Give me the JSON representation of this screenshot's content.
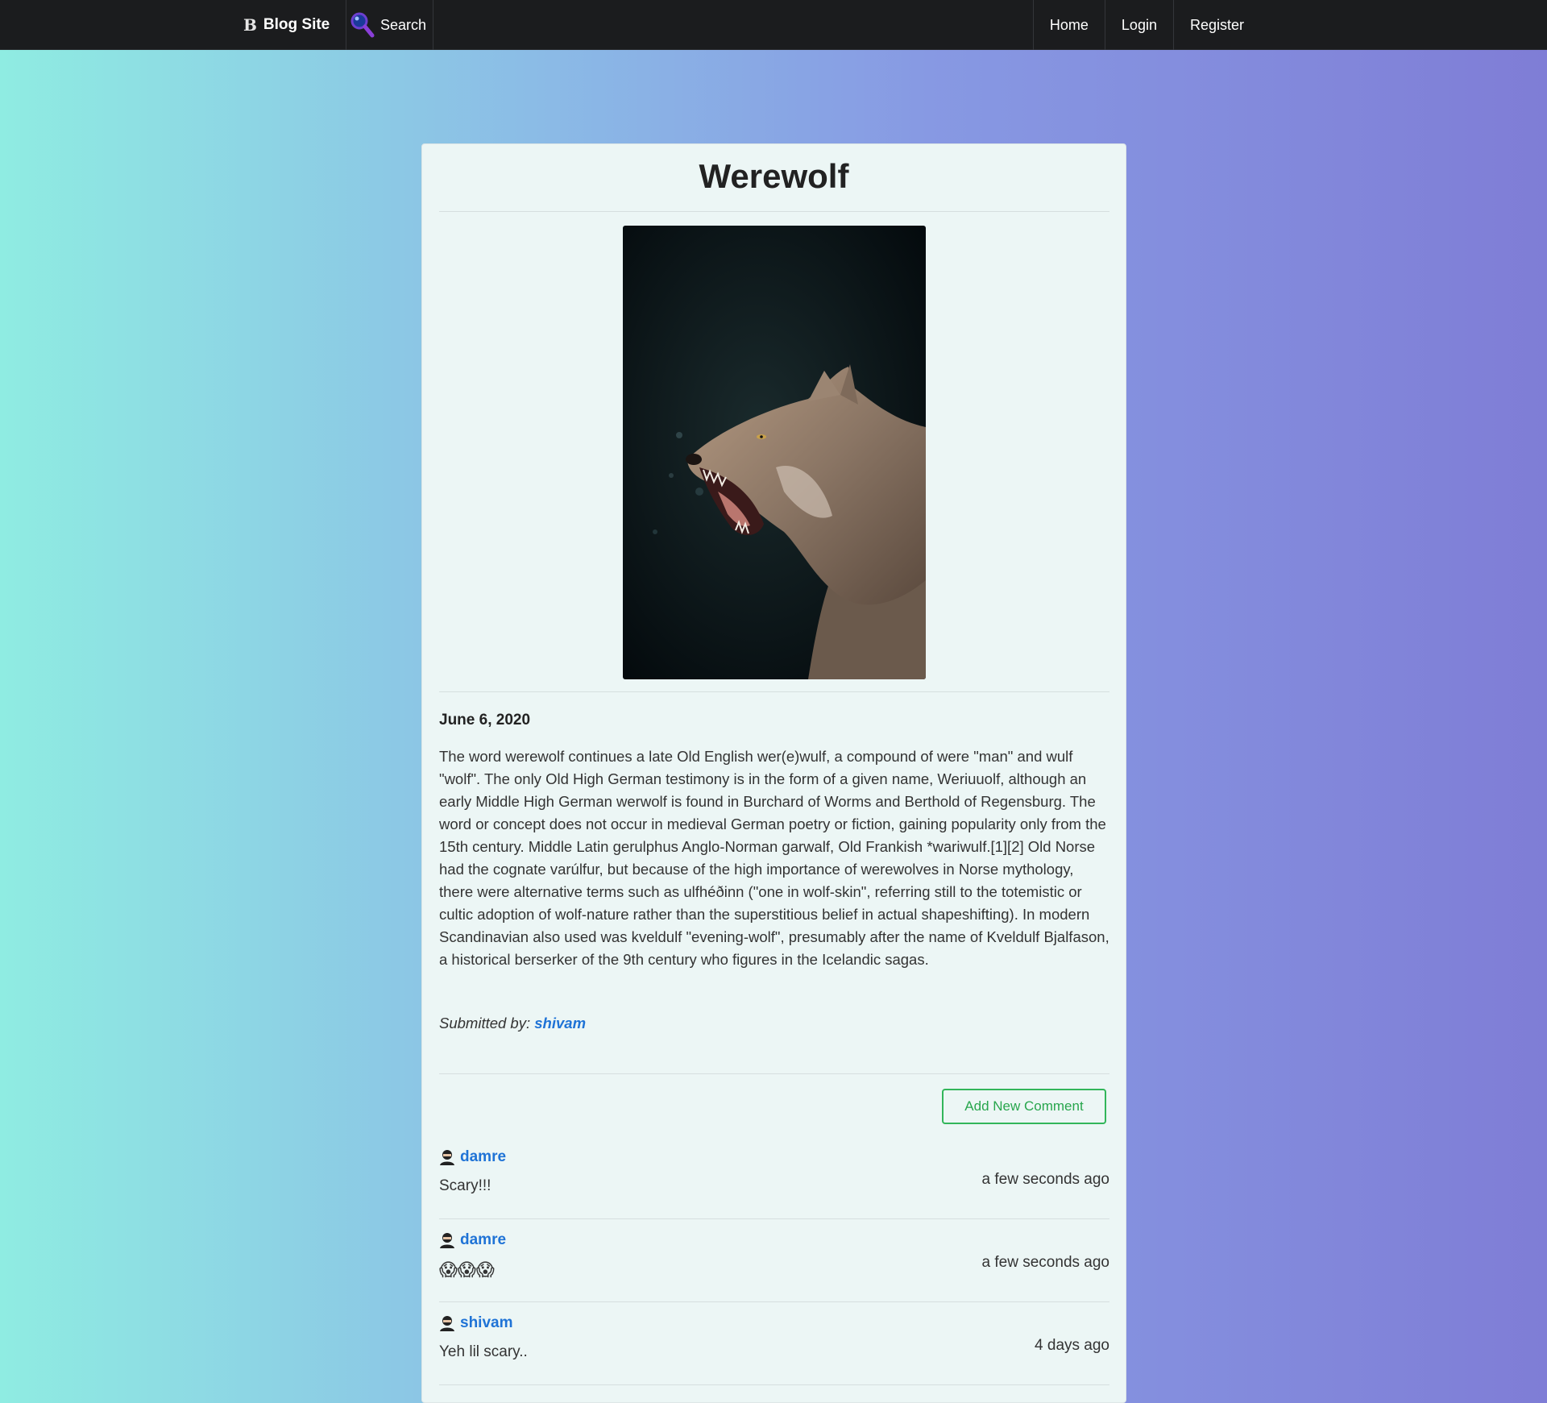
{
  "navbar": {
    "brand_icon": "B",
    "brand": "Blog Site",
    "search": "Search",
    "items": [
      "Home",
      "Login",
      "Register"
    ]
  },
  "post": {
    "title": "Werewolf",
    "image_alt": "wolf-snarling-photo",
    "date": "June 6, 2020",
    "body": "The word werewolf continues a late Old English wer(e)wulf, a compound of were \"man\" and wulf \"wolf\". The only Old High German testimony is in the form of a given name, Weriuuolf, although an early Middle High German werwolf is found in Burchard of Worms and Berthold of Regensburg. The word or concept does not occur in medieval German poetry or fiction, gaining popularity only from the 15th century. Middle Latin gerulphus Anglo-Norman garwalf, Old Frankish *wariwulf.[1][2] Old Norse had the cognate varúlfur, but because of the high importance of werewolves in Norse mythology, there were alternative terms such as ulfhéðinn (\"one in wolf-skin\", referring still to the totemistic or cultic adoption of wolf-nature rather than the superstitious belief in actual shapeshifting). In modern Scandinavian also used was kveldulf \"evening-wolf\", presumably after the name of Kveldulf Bjalfason, a historical berserker of the 9th century who figures in the Icelandic sagas.",
    "submitted_label": "Submitted by:",
    "author": "shivam"
  },
  "comments_section": {
    "add_button": "Add New Comment",
    "comments": [
      {
        "author": "damre",
        "text": "Scary!!!",
        "time": "a few seconds ago"
      },
      {
        "author": "damre",
        "text": "😱😱😱",
        "time": "a few seconds ago"
      },
      {
        "author": "shivam",
        "text": "Yeh lil scary..",
        "time": "4 days ago"
      }
    ]
  },
  "colors": {
    "navbar_bg": "#1b1c1e",
    "link": "#1f73d6",
    "button_green": "#32b65a",
    "card_bg": "#ecf6f5"
  }
}
